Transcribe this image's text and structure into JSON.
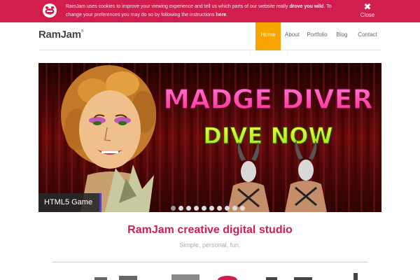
{
  "cookie_bar": {
    "text_1": "RamJam uses cookies to improve your viewing experience and tell us which parts of our website really ",
    "text_bold": "drove you wild",
    "text_2": ". To change your preferences you may do so by following the instructions ",
    "link": "here",
    "text_end": ".",
    "close_label": "Close",
    "close_icon": "✖"
  },
  "header": {
    "logo": "RamJam",
    "logo_mark": "®",
    "nav": [
      "Home",
      "About",
      "Portfolio",
      "Blog",
      "Contact"
    ]
  },
  "hero": {
    "title_line_1": "MADGE DIVER",
    "title_line_2": "DIVE NOW",
    "caption": "HTML5 Game",
    "slide_count": 10,
    "active_slide": 1
  },
  "studio": {
    "title": "RamJam creative digital studio",
    "subtitle": "Simple, personal, fun."
  },
  "colors": {
    "brand": "#d11e4e",
    "nav_active": "#f7a300",
    "caption_accent": "#5b3fb0"
  }
}
